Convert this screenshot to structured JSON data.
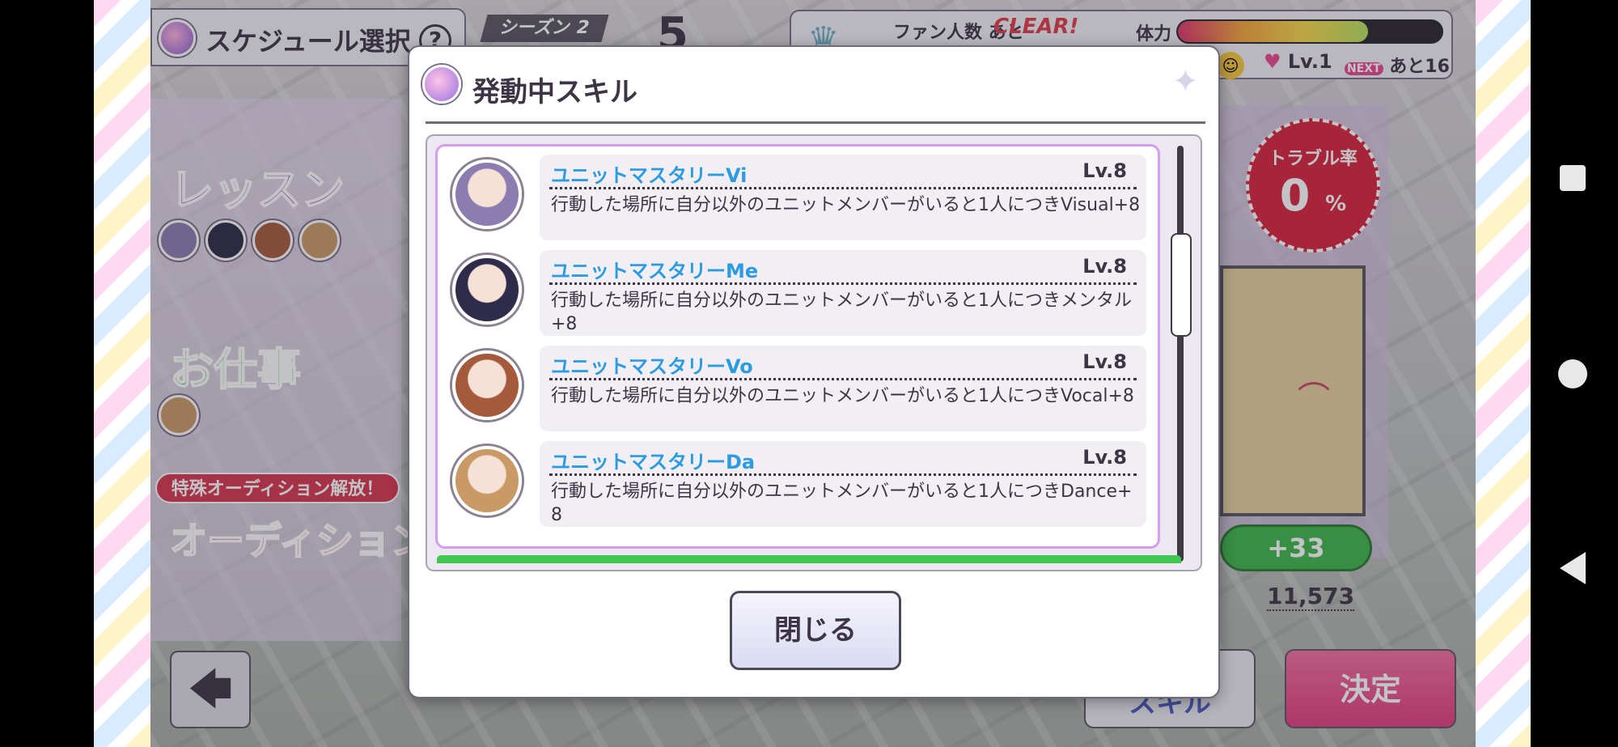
{
  "header": {
    "schedule_title": "スケジュール選択",
    "help_label": "?",
    "season_label": "シーズン 2",
    "big_number": "5",
    "fan_label": "ファン人数 あと",
    "clear_label": "CLEAR!",
    "stamina_label": "体力",
    "stamina_fraction": 0.72,
    "heart_level": "Lv.1",
    "next_label": "NEXT",
    "next_remaining": "あと16"
  },
  "menu": {
    "lesson_label": "レッスン",
    "work_label": "お仕事",
    "audition_banner": "特殊オーディション解放！",
    "audition_label": "オーディション"
  },
  "right_panel": {
    "trouble_label": "トラブル率",
    "trouble_value": "0",
    "trouble_unit": "%",
    "gain_label": "+33",
    "fan_total": "11,573"
  },
  "footer": {
    "back_icon": "arrow-left-icon",
    "back_glyph": "🡄",
    "skill_button_label": "スキル",
    "decide_button_label": "決定"
  },
  "modal": {
    "title": "発動中スキル",
    "close_label": "閉じる",
    "skills": [
      {
        "name": "ユニットマスタリーVi",
        "level": "Lv.8",
        "description": "行動した場所に自分以外のユニットメンバーがいると1人につきVisual+8",
        "avatar_color": "#8b7db0"
      },
      {
        "name": "ユニットマスタリーMe",
        "level": "Lv.8",
        "description": "行動した場所に自分以外のユニットメンバーがいると1人につきメンタル+8",
        "avatar_color": "#2e2c4a"
      },
      {
        "name": "ユニットマスタリーVo",
        "level": "Lv.8",
        "description": "行動した場所に自分以外のユニットメンバーがいると1人につきVocal+8",
        "avatar_color": "#a65a3c"
      },
      {
        "name": "ユニットマスタリーDa",
        "level": "Lv.8",
        "description": "行動した場所に自分以外のユニットメンバーがいると1人につきDance+8",
        "avatar_color": "#c99a66"
      }
    ]
  },
  "colors": {
    "accent_blue": "#2d9be0",
    "decide_pink": "#e33d7e",
    "trouble_red": "#d8243d",
    "gain_green": "#3fb64a"
  }
}
